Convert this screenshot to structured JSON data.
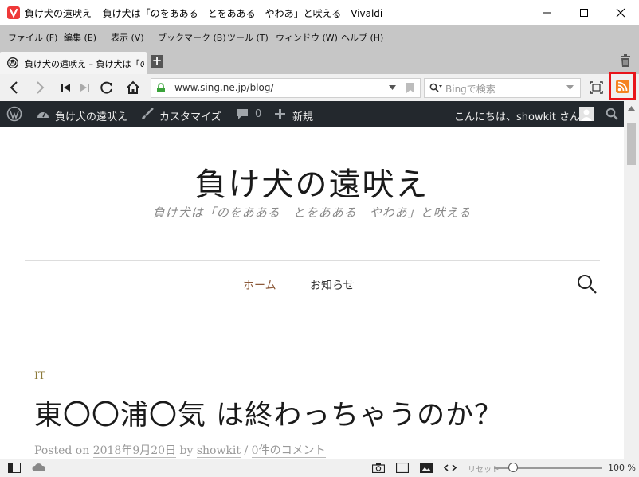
{
  "window": {
    "title": "負け犬の遠吠え – 負け犬は「のをあある　とをあある　やわあ」と吠える - Vivaldi"
  },
  "menu": [
    "ファイル (F)",
    "編集 (E)",
    "表示 (V)",
    "ブックマーク (B)",
    "ツール (T)",
    "ウィンドウ (W)",
    "ヘルプ (H)"
  ],
  "tab": {
    "title": "負け犬の遠吠え – 負け犬は「のを"
  },
  "address": {
    "url": "www.sing.ne.jp/blog/",
    "search_placeholder": "Bingで検索"
  },
  "admin_bar": {
    "site_name": "負け犬の遠吠え",
    "customize": "カスタマイズ",
    "comments_count": "0",
    "new": "新規",
    "greeting": "こんにちは、showkit さん"
  },
  "site": {
    "title": "負け犬の遠吠え",
    "description": "負け犬は「のをあある　とをあある　やわあ」と吠える",
    "nav": [
      "ホーム",
      "お知らせ"
    ]
  },
  "post": {
    "category": "IT",
    "title": "東〇〇浦〇気 は終わっちゃうのか？",
    "posted_on": "Posted on",
    "date": "2018年9月20日",
    "by": "by",
    "author": "showkit",
    "separator": "/",
    "comments": "0件のコメント"
  },
  "status": {
    "zoom_reset": "リセット",
    "zoom_level": "100 %",
    "zoom_fraction": 0.18
  },
  "colors": {
    "accent_rss": "#f58220",
    "highlight": "#e8141a",
    "nav_active": "#8c5a3a"
  }
}
